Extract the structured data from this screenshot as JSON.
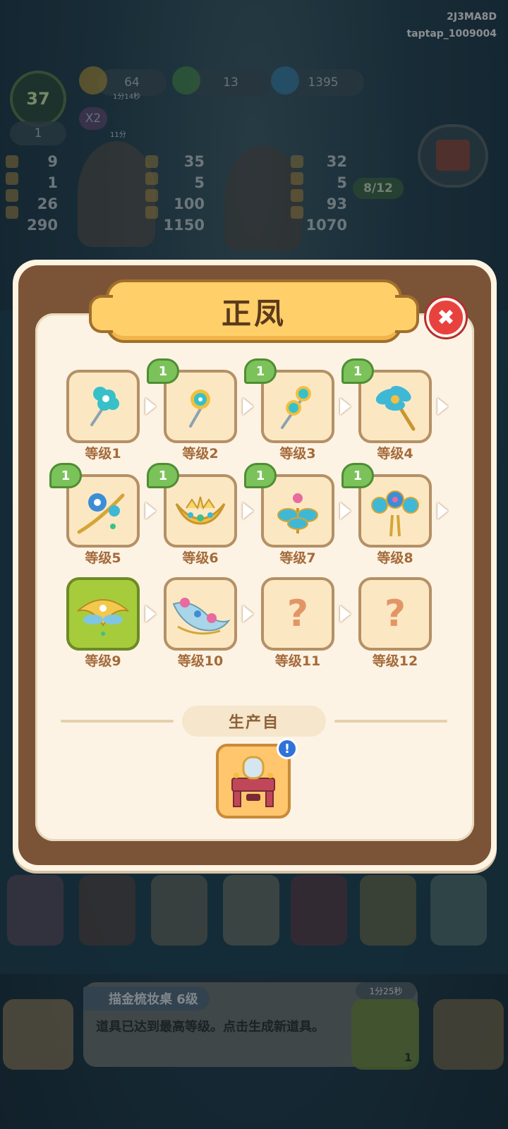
{
  "header": {
    "user_code": "2J3MA8D",
    "account": "taptap_1009004"
  },
  "background": {
    "player_level": "37",
    "resources": [
      {
        "name": "energy",
        "value": "64",
        "sub": "1分14秒"
      },
      {
        "name": "jade",
        "value": "13"
      },
      {
        "name": "flame",
        "value": "1395"
      }
    ],
    "multiplier": "X2",
    "multiplier_timer": "11分",
    "flower_count": "1",
    "stats_columns": [
      [
        "9",
        "1",
        "26",
        "290"
      ],
      [
        "35",
        "5",
        "100",
        "1150"
      ],
      [
        "32",
        "5",
        "93",
        "1070"
      ]
    ],
    "order_progress": "8/12",
    "info_bar": {
      "title": "描金梳妆桌 6级",
      "description": "道具已达到最高等级。点击生成新道具。",
      "timer": "1分25秒",
      "coin_count": "1"
    }
  },
  "modal": {
    "title": "正凤",
    "close_label": "✖",
    "levels": [
      {
        "label": "等级1",
        "badge": null,
        "icon": "blue-flower-hairpin-icon",
        "state": "unlocked"
      },
      {
        "label": "等级2",
        "badge": "1",
        "icon": "double-flower-hairpin-icon",
        "state": "unlocked"
      },
      {
        "label": "等级3",
        "badge": "1",
        "icon": "triple-flower-hairpin-icon",
        "state": "unlocked"
      },
      {
        "label": "等级4",
        "badge": "1",
        "icon": "gold-leaf-hairpin-icon",
        "state": "unlocked"
      },
      {
        "label": "等级5",
        "badge": "1",
        "icon": "pearl-branch-hairpin-icon",
        "state": "unlocked"
      },
      {
        "label": "等级6",
        "badge": "1",
        "icon": "tiara-icon",
        "state": "unlocked"
      },
      {
        "label": "等级7",
        "badge": "1",
        "icon": "gold-bouquet-hairpin-icon",
        "state": "unlocked"
      },
      {
        "label": "等级8",
        "badge": "1",
        "icon": "flower-fan-hairpin-icon",
        "state": "unlocked"
      },
      {
        "label": "等级9",
        "badge": null,
        "icon": "phoenix-crown-icon",
        "state": "current"
      },
      {
        "label": "等级10",
        "badge": null,
        "icon": "phoenix-headdress-icon",
        "state": "unlocked"
      },
      {
        "label": "等级11",
        "badge": null,
        "icon": "question-mark-icon",
        "state": "locked",
        "placeholder": "?"
      },
      {
        "label": "等级12",
        "badge": null,
        "icon": "question-mark-icon",
        "state": "locked",
        "placeholder": "?"
      }
    ],
    "produced_from_label": "生产自",
    "source": {
      "icon": "vanity-table-icon",
      "alert": "!"
    }
  }
}
